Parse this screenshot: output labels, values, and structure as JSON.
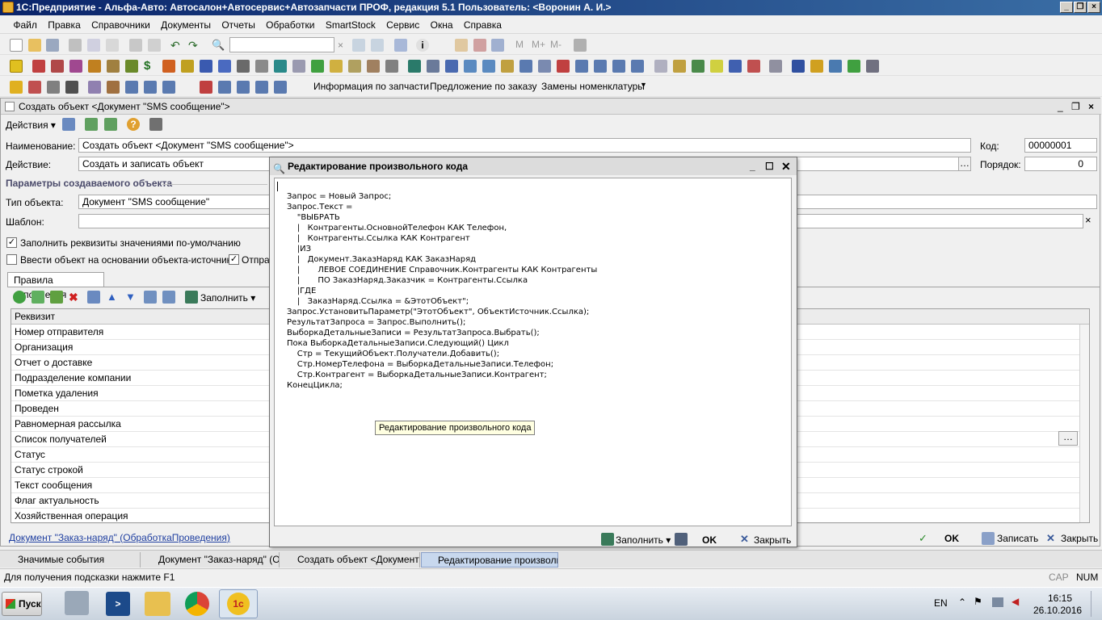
{
  "window": {
    "title": "1С:Предприятие - Альфа-Авто: Автосалон+Автосервис+Автозапчасти ПРОФ, редакция 5.1    Пользователь: <Воронин А. И.>"
  },
  "menu": [
    "Файл",
    "Правка",
    "Справочники",
    "Документы",
    "Отчеты",
    "Обработки",
    "SmartStock",
    "Сервис",
    "Окна",
    "Справка"
  ],
  "toolbar3": {
    "link1": "Информация по запчасти",
    "link2": "Предложение по заказу",
    "link3": "Замены номенклатуры"
  },
  "doc": {
    "title": "Создать объект <Документ \"SMS сообщение\">",
    "actions": "Действия",
    "name_label": "Наименование:",
    "name_value": "Создать объект <Документ \"SMS сообщение\">",
    "code_label": "Код:",
    "code_value": "00000001",
    "action_label": "Действие:",
    "action_value": "Создать и записать объект",
    "order_label": "Порядок:",
    "order_value": "0",
    "params_header": "Параметры создаваемого объекта",
    "type_label": "Тип объекта:",
    "type_value": "Документ \"SMS сообщение\"",
    "template_label": "Шаблон:",
    "fill_defaults": "Заполнить реквизиты значениями по-умолчанию",
    "based_on": "Ввести объект на основании объекта-источника",
    "otpr": "Отпра",
    "tab_rules": "Правила заполнения",
    "fill_btn": "Заполнить",
    "grid_header": "Реквизит",
    "rows": [
      "Номер отправителя",
      "Организация",
      "Отчет о доставке",
      "Подразделение компании",
      "Пометка удаления",
      "Проведен",
      "Равномерная рассылка",
      "Список получателей",
      "Статус",
      "Статус строкой",
      "Текст сообщения",
      "Флаг актуальность",
      "Хозяйственная операция"
    ],
    "bottom_link": "Документ \"Заказ-наряд\" (ОбработкаПроведения)",
    "ok": "OK",
    "save": "Записать",
    "close": "Закрыть"
  },
  "code": {
    "title": "Редактирование произвольного кода",
    "text": "Запрос = Новый Запрос;\nЗапрос.Текст =\n    \"ВЫБРАТЬ\n    |   Контрагенты.ОсновнойТелефон КАК Телефон,\n    |   Контрагенты.Ссылка КАК Контрагент\n    |ИЗ\n    |   Документ.ЗаказНаряд КАК ЗаказНаряд\n    |       ЛЕВОЕ СОЕДИНЕНИЕ Справочник.Контрагенты КАК Контрагенты\n    |       ПО ЗаказНаряд.Заказчик = Контрагенты.Ссылка\n    |ГДЕ\n    |   ЗаказНаряд.Ссылка = &ЭтотОбъект\";\nЗапрос.УстановитьПараметр(\"ЭтотОбъект\", ОбъектИсточник.Ссылка);\nРезультатЗапроса = Запрос.Выполнить();\nВыборкаДетальныеЗаписи = РезультатЗапроса.Выбрать();\nПока ВыборкаДетальныеЗаписи.Следующий() Цикл\n    Стр = ТекущийОбъект.Получатели.Добавить();\n    Стр.НомерТелефона = ВыборкаДетальныеЗаписи.Телефон;\n    Стр.Контрагент = ВыборкаДетальныеЗаписи.Контрагент;\nКонецЦикла;",
    "tooltip": "Редактирование произвольного кода",
    "fill": "Заполнить",
    "ok": "OK",
    "close": "Закрыть"
  },
  "tasks": [
    "Значимые события",
    "Документ \"Заказ-наряд\" (ОбработкаПроведения)",
    "Создать объект <Документ \"SMS сообщение\">",
    "Редактирование произвольного кода"
  ],
  "status": {
    "hint": "Для получения подсказки нажмите F1",
    "cap": "CAP",
    "num": "NUM"
  },
  "taskbar": {
    "start": "Пуск",
    "lang": "EN",
    "time": "16:15",
    "date": "26.10.2016"
  }
}
